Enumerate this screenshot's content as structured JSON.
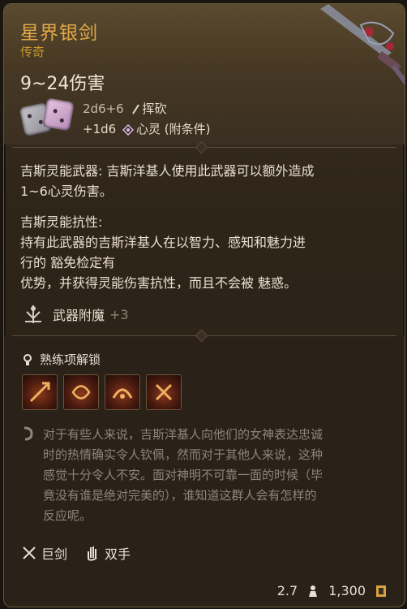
{
  "item": {
    "name": "星界银剑",
    "rarity": "传奇",
    "damage_total": "9~24伤害",
    "damage_line1_dice": "2d6+6",
    "damage_line1_type": "挥砍",
    "damage_line2_dice": "+1d6",
    "damage_line2_type": "心灵 (附条件)"
  },
  "abilities": {
    "weapon_line1": "吉斯灵能武器: 吉斯洋基人使用此武器可以额外造成",
    "weapon_line2": "1~6心灵伤害。",
    "resist_title": "吉斯灵能抗性:",
    "resist_line1": "持有此武器的吉斯洋基人在以智力、感知和魅力进",
    "resist_line2": "行的 豁免检定有",
    "resist_line3": "优势，并获得灵能伤害抗性，而且不会被 魅惑。"
  },
  "enchantment": {
    "label": "武器附魔",
    "value": "+3"
  },
  "proficiency": {
    "header": "熟练项解锁",
    "skills": [
      "skill-1",
      "skill-2",
      "skill-3",
      "skill-4"
    ]
  },
  "flavor": {
    "line1": "对于有些人来说，吉斯洋基人向他们的女神表达忠诚",
    "line2": "时的热情确实令人钦佩，然而对于其他人来说，这种",
    "line3": "感觉十分令人不安。面对神明不可靠一面的时候（毕",
    "line4": "竟没有谁是绝对完美的），谁知道这群人会有怎样的",
    "line5": "反应呢。"
  },
  "properties": {
    "type": "巨剑",
    "hands": "双手"
  },
  "footer": {
    "weight": "2.7",
    "value": "1,300"
  },
  "colors": {
    "title": "#e4a94a",
    "rarity": "#c9962f",
    "flavor": "#8f8677"
  }
}
